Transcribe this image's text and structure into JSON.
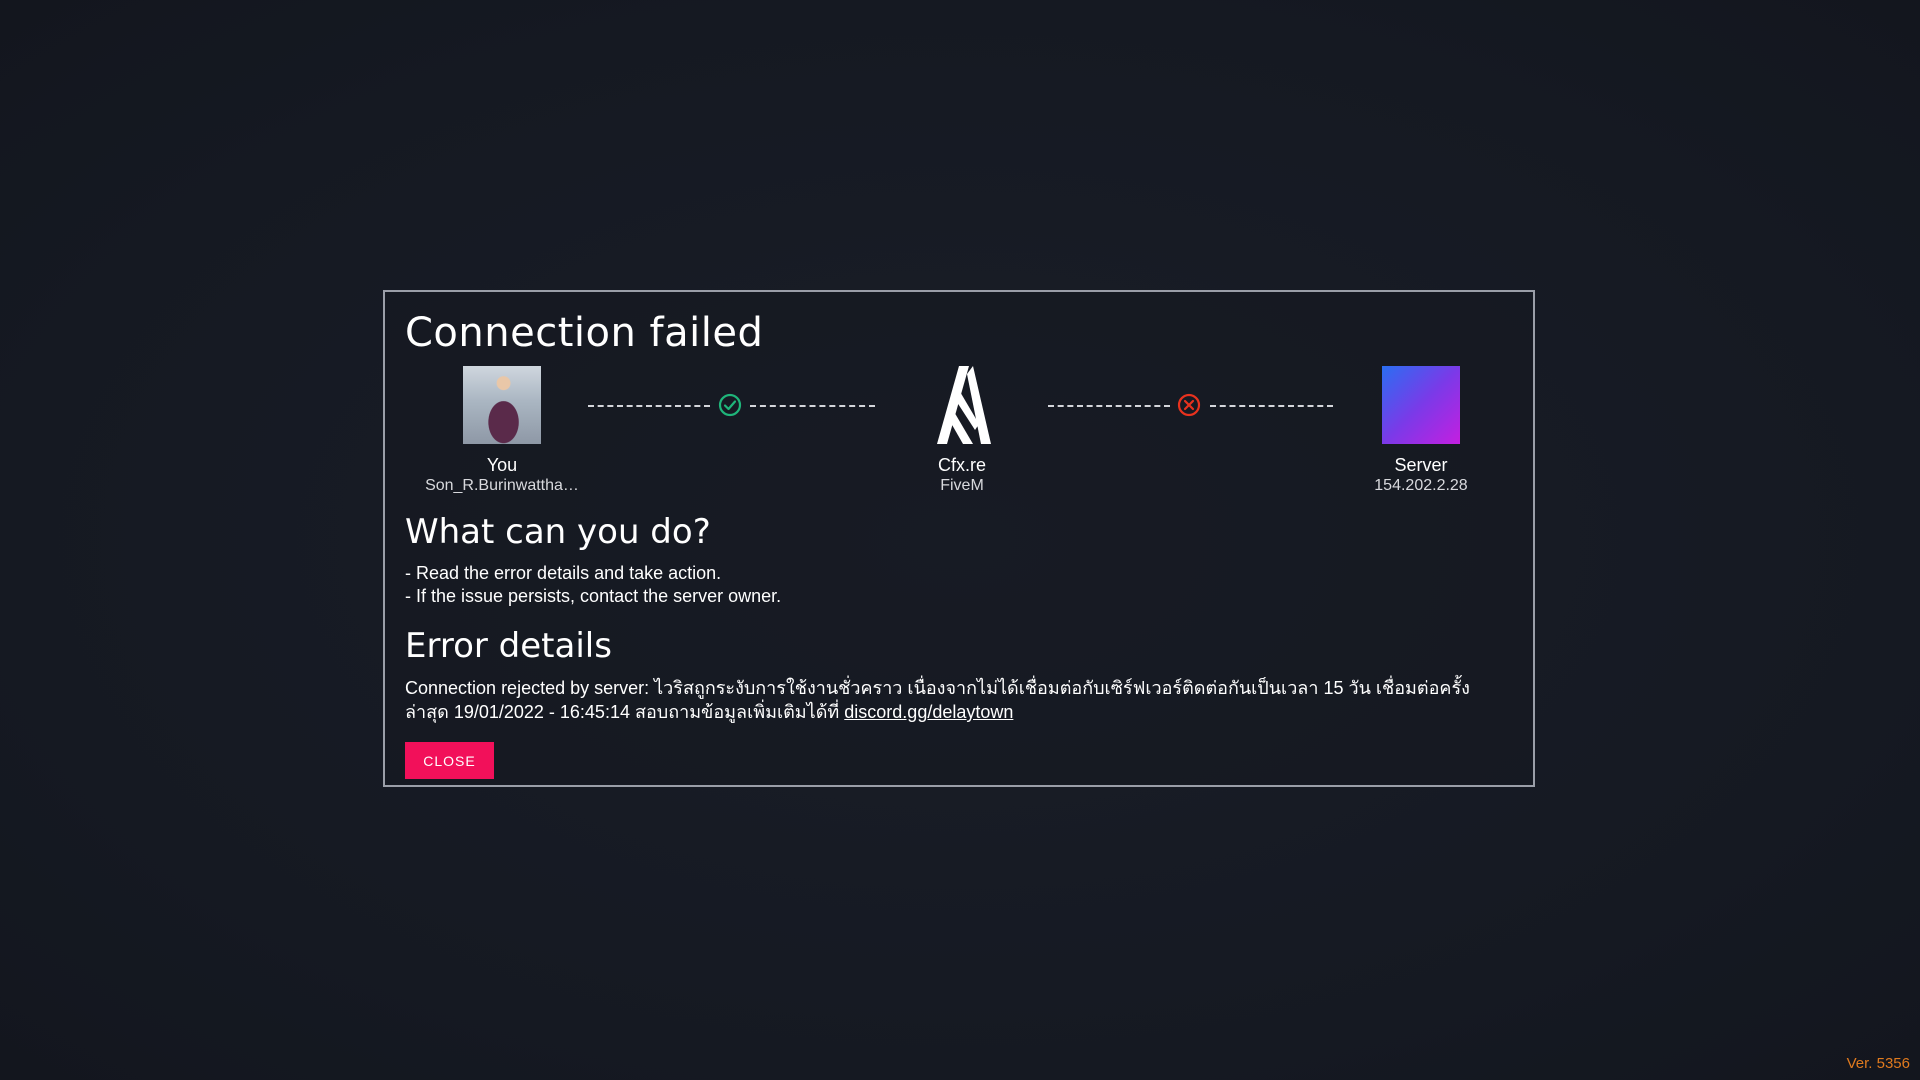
{
  "dialog": {
    "title": "Connection failed",
    "nodes": {
      "you": {
        "label": "You",
        "sub": "Son_R.Burinwattha…"
      },
      "cfx": {
        "label": "Cfx.re",
        "sub": "FiveM"
      },
      "server": {
        "label": "Server",
        "sub": "154.202.2.28"
      }
    },
    "links": {
      "you_to_cfx": {
        "status": "success",
        "icon": "check-circle-icon",
        "color": "#1fb57a"
      },
      "cfx_to_server": {
        "status": "failed",
        "icon": "x-circle-icon",
        "color": "#e8321e"
      }
    },
    "help": {
      "title": "What can you do?",
      "steps": [
        "- Read the error details and take action.",
        "- If the issue persists, contact the server owner."
      ]
    },
    "error": {
      "title": "Error details",
      "text": "Connection rejected by server: ไวริสถูกระงับการใช้งานชั่วคราว เนื่องจากไม่ได้เชื่อมต่อกับเซิร์ฟเวอร์ติดต่อกันเป็นเวลา 15 วัน เชื่อมต่อครั้งล่าสุด 19/01/2022 - 16:45:14 สอบถามข้อมูลเพิ่มเติมได้ที่ ",
      "link": "discord.gg/delaytown"
    },
    "close_label": "CLOSE"
  },
  "version": "Ver. 5356",
  "colors": {
    "background": "#161a23",
    "accent": "#f2105a",
    "version": "#e07a1e"
  }
}
